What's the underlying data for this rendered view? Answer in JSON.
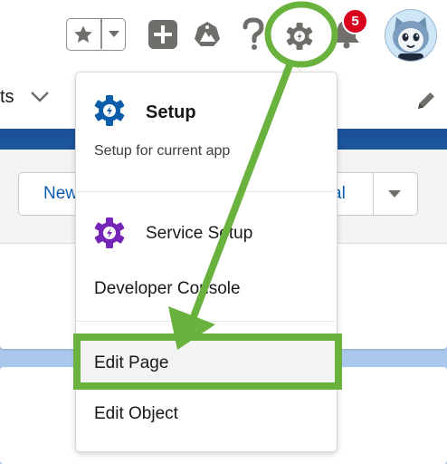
{
  "header": {
    "favorites_icon": "star-icon",
    "favorites_menu_icon": "chevron-down-icon",
    "global_actions_icon": "plus-icon",
    "trailhead_icon": "trailhead-icon",
    "help_icon": "question-icon",
    "setup_icon": "gear-icon",
    "notifications_icon": "bell-icon",
    "notification_count": "5",
    "avatar_icon": "astro-avatar"
  },
  "nav": {
    "tab_partial_label": "ts",
    "tab_menu_icon": "chevron-down-icon",
    "edit_nav_icon": "pencil-icon"
  },
  "page": {
    "action_new_partial": "New",
    "action_partial_right": "al",
    "action_more_icon": "chevron-down-icon"
  },
  "setup_menu": {
    "setup_title": "Setup",
    "setup_subtitle": "Setup for current app",
    "service_setup": "Service Setup",
    "developer_console": "Developer Console",
    "edit_page": "Edit Page",
    "edit_object": "Edit Object"
  },
  "colors": {
    "annotation_green": "#6ab23e",
    "setup_gear_blue": "#0b5cab",
    "service_gear_purple": "#7526b8",
    "badge_red": "#d9001e",
    "link_blue": "#0b5cab"
  }
}
